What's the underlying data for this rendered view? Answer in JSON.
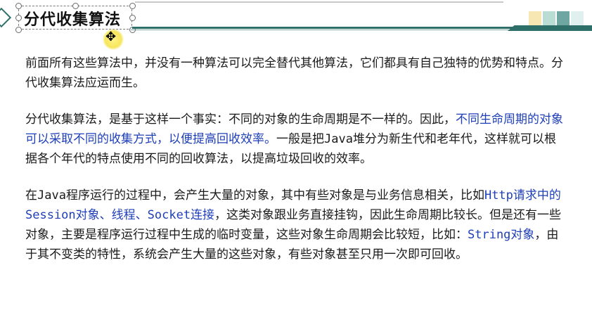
{
  "slide": {
    "title": "分代收集算法",
    "colors": {
      "accent_dark": "#2f6f6a",
      "link": "#1e3fb8",
      "swatches": [
        "#f6e7b3",
        "#b9ddd4",
        "#6ea7a2",
        "#dff0ee"
      ]
    },
    "paragraphs": {
      "p1": "前面所有这些算法中，并没有一种算法可以完全替代其他算法，它们都具有自己独特的优势和特点。分代收集算法应运而生。",
      "p2_a": "分代收集算法，是基于这样一个事实：不同的对象的生命周期是不一样的。因此，",
      "p2_link": "不同生命周期的对象可以采取不同的收集方式，以便提高回收效率。",
      "p2_b": "一般是把",
      "p2_java": "Java",
      "p2_c": "堆分为新生代和老年代，这样就可以根据各个年代的特点使用不同的回收算法，以提高垃圾回收的效率。",
      "p3_a": "在",
      "p3_java": "Java",
      "p3_b": "程序运行的过程中，会产生大量的对象，其中有些对象是与业务信息相关，比如",
      "p3_link1": "Http请求中的Session对象、线程、Socket连接",
      "p3_c": "，这类对象跟业务直接挂钩，因此生命周期比较长。但是还有一些对象，主要是程序运行过程中生成的临时变量，这些对象生命周期会比较短，比如：",
      "p3_link2": "String对象",
      "p3_d": "，由于其不变类的特性，系统会产生大量的这些对象，有些对象甚至只用一次即可回收。"
    }
  },
  "icons": {
    "cursor": "move-cursor-icon",
    "diamond": "diamond-icon"
  }
}
